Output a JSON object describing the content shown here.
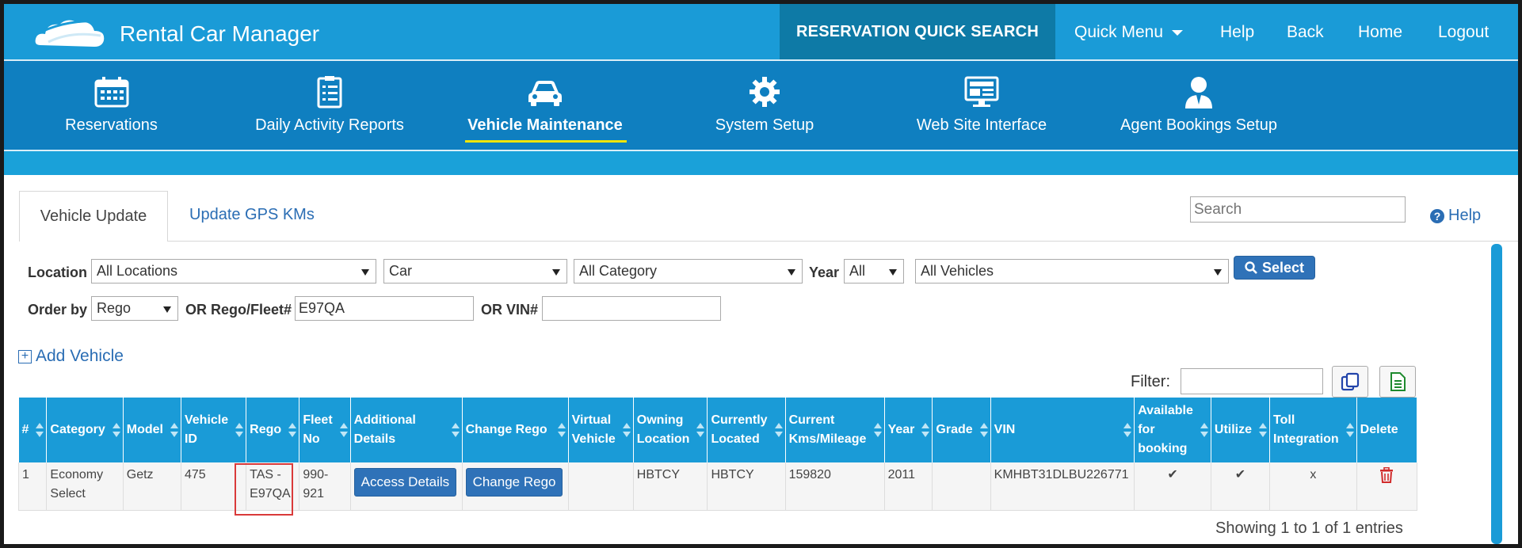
{
  "app": {
    "title": "Rental Car Manager"
  },
  "topnav": {
    "quick_search": "RESERVATION QUICK SEARCH",
    "quick_menu": "Quick Menu",
    "help": "Help",
    "back": "Back",
    "home": "Home",
    "logout": "Logout"
  },
  "nav": {
    "items": [
      {
        "label": "Reservations",
        "icon": "calendar-icon"
      },
      {
        "label": "Daily Activity Reports",
        "icon": "clipboard-icon"
      },
      {
        "label": "Vehicle Maintenance",
        "icon": "car-icon",
        "active": true
      },
      {
        "label": "System Setup",
        "icon": "gear-icon"
      },
      {
        "label": "Web Site Interface",
        "icon": "monitor-icon"
      },
      {
        "label": "Agent Bookings Setup",
        "icon": "agent-icon"
      }
    ]
  },
  "tabs": {
    "active": "Vehicle Update",
    "other": "Update GPS KMs"
  },
  "search": {
    "placeholder": "Search"
  },
  "help_link": "Help",
  "filters": {
    "location_label": "Location",
    "location_value": "All Locations",
    "type_value": "Car",
    "category_value": "All Category",
    "year_label": "Year",
    "year_value": "All",
    "vehicles_value": "All Vehicles",
    "select_button": "Select",
    "order_label": "Order by",
    "order_value": "Rego",
    "rego_label": "OR Rego/Fleet#",
    "rego_value": "E97QA",
    "vin_label": "OR VIN#",
    "vin_value": ""
  },
  "add_vehicle": "Add Vehicle",
  "filter_label": "Filter:",
  "table": {
    "headers": [
      "#",
      "Category",
      "Model",
      "Vehicle ID",
      "Rego",
      "Fleet No",
      "Additional Details",
      "Change Rego",
      "Virtual Vehicle",
      "Owning Location",
      "Currently Located",
      "Current Kms/Mileage",
      "Year",
      "Grade",
      "VIN",
      "Available for booking",
      "Utilize",
      "Toll Integration",
      "Delete"
    ],
    "rows": [
      {
        "num": "1",
        "category": "Economy Select",
        "model": "Getz",
        "vehicle_id": "475",
        "rego": "TAS - E97QA",
        "fleet_no": "990-921",
        "additional_details": "Access Details",
        "change_rego": "Change Rego",
        "virtual_vehicle": "",
        "owning_location": "HBTCY",
        "currently_located": "HBTCY",
        "kms": "159820",
        "year": "2011",
        "grade": "",
        "vin": "KMHBT31DLBU226771",
        "available": "✔",
        "utilize": "✔",
        "toll": "x"
      }
    ]
  },
  "showing": "Showing 1 to 1 of 1 entries",
  "colors": {
    "topbar": "#1a9bd7",
    "navbar": "#0f7fc0",
    "quick_search_bg": "#0e7aa6",
    "button": "#2f72b8",
    "active_underline": "#f2e500",
    "highlight": "#d93a3a"
  }
}
